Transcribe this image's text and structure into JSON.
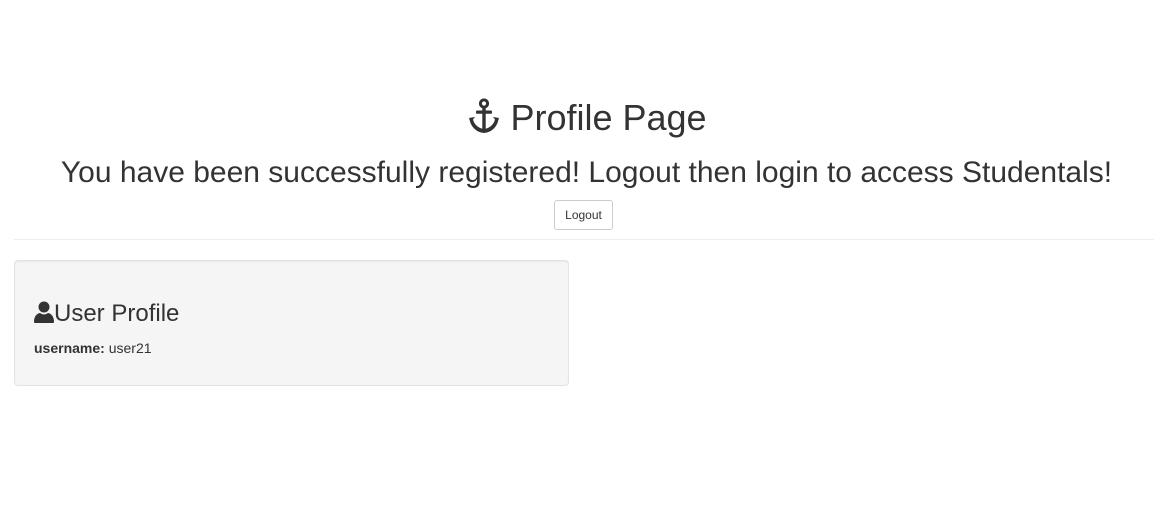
{
  "header": {
    "title": "Profile Page",
    "title_icon": "anchor-icon",
    "message": "You have been successfully registered! Logout then login to access Studentals!",
    "logout_label": "Logout"
  },
  "profile_card": {
    "title": "User Profile",
    "title_icon": "user-icon",
    "fields": [
      {
        "label": "username:",
        "value": "user21"
      }
    ]
  },
  "colors": {
    "text": "#333333",
    "card_background": "#f5f5f5",
    "card_border": "#e3e3e3",
    "divider": "#eeeeee",
    "button_border": "#cccccc"
  }
}
